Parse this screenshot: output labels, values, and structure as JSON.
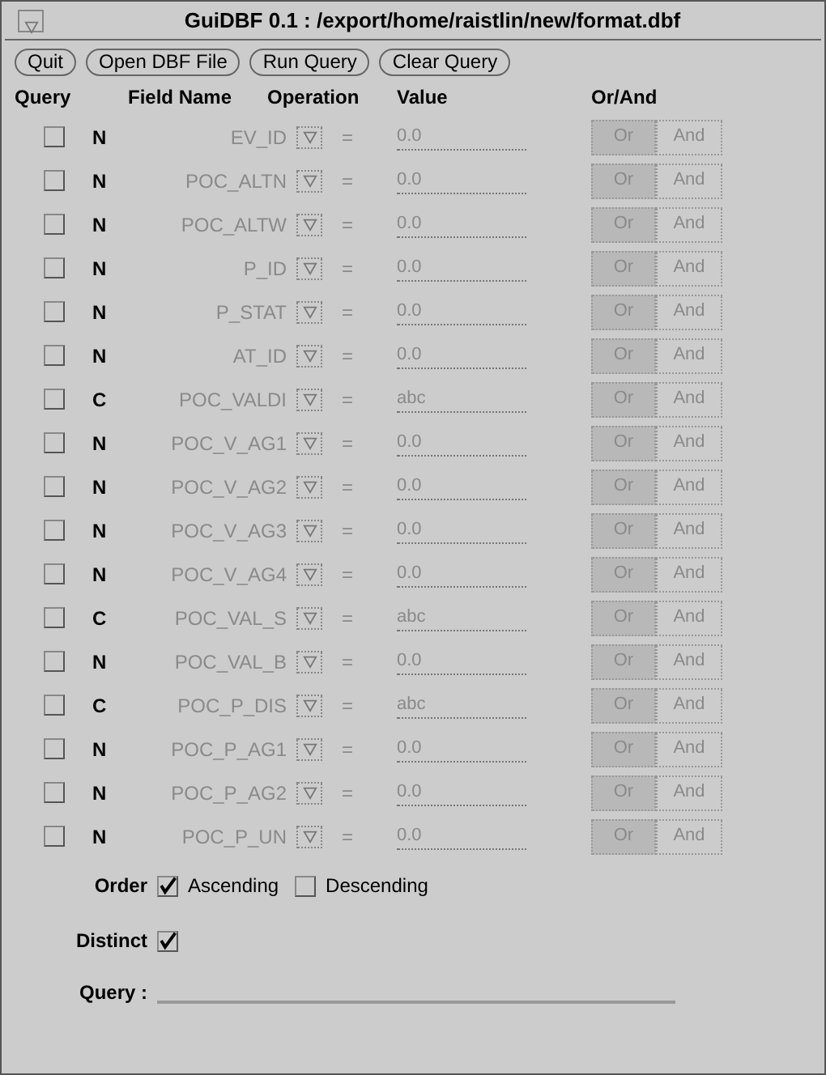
{
  "window": {
    "title": "GuiDBF 0.1 : /export/home/raistlin/new/format.dbf"
  },
  "buttons": [
    "Quit",
    "Open DBF File",
    "Run Query",
    "Clear Query"
  ],
  "columns": [
    "Query",
    "Field Name",
    "Operation",
    "Value",
    "Or/And"
  ],
  "rows": [
    {
      "checked": false,
      "type": "N",
      "field_name": "EV_ID",
      "operation": "=",
      "value": "0.0",
      "disabled": true,
      "or": {
        "label": "Or",
        "selected": true
      },
      "and": {
        "label": "And",
        "selected": false
      }
    },
    {
      "checked": false,
      "type": "N",
      "field_name": "POC_ALTN",
      "operation": "=",
      "value": "0.0",
      "disabled": true,
      "or": {
        "label": "Or",
        "selected": true
      },
      "and": {
        "label": "And",
        "selected": false
      }
    },
    {
      "checked": false,
      "type": "N",
      "field_name": "POC_ALTW",
      "operation": "=",
      "value": "0.0",
      "disabled": true,
      "or": {
        "label": "Or",
        "selected": true
      },
      "and": {
        "label": "And",
        "selected": false
      }
    },
    {
      "checked": false,
      "type": "N",
      "field_name": "P_ID",
      "operation": "=",
      "value": "0.0",
      "disabled": true,
      "or": {
        "label": "Or",
        "selected": true
      },
      "and": {
        "label": "And",
        "selected": false
      }
    },
    {
      "checked": false,
      "type": "N",
      "field_name": "P_STAT",
      "operation": "=",
      "value": "0.0",
      "disabled": true,
      "or": {
        "label": "Or",
        "selected": true
      },
      "and": {
        "label": "And",
        "selected": false
      }
    },
    {
      "checked": false,
      "type": "N",
      "field_name": "AT_ID",
      "operation": "=",
      "value": "0.0",
      "disabled": true,
      "or": {
        "label": "Or",
        "selected": true
      },
      "and": {
        "label": "And",
        "selected": false
      }
    },
    {
      "checked": false,
      "type": "C",
      "field_name": "POC_VALDI",
      "operation": "=",
      "value": "abc",
      "disabled": true,
      "or": {
        "label": "Or",
        "selected": true
      },
      "and": {
        "label": "And",
        "selected": false
      }
    },
    {
      "checked": false,
      "type": "N",
      "field_name": "POC_V_AG1",
      "operation": "=",
      "value": "0.0",
      "disabled": true,
      "or": {
        "label": "Or",
        "selected": true
      },
      "and": {
        "label": "And",
        "selected": false
      }
    },
    {
      "checked": false,
      "type": "N",
      "field_name": "POC_V_AG2",
      "operation": "=",
      "value": "0.0",
      "disabled": true,
      "or": {
        "label": "Or",
        "selected": true
      },
      "and": {
        "label": "And",
        "selected": false
      }
    },
    {
      "checked": false,
      "type": "N",
      "field_name": "POC_V_AG3",
      "operation": "=",
      "value": "0.0",
      "disabled": true,
      "or": {
        "label": "Or",
        "selected": true
      },
      "and": {
        "label": "And",
        "selected": false
      }
    },
    {
      "checked": false,
      "type": "N",
      "field_name": "POC_V_AG4",
      "operation": "=",
      "value": "0.0",
      "disabled": true,
      "or": {
        "label": "Or",
        "selected": true
      },
      "and": {
        "label": "And",
        "selected": false
      }
    },
    {
      "checked": false,
      "type": "C",
      "field_name": "POC_VAL_S",
      "operation": "=",
      "value": "abc",
      "disabled": true,
      "or": {
        "label": "Or",
        "selected": true
      },
      "and": {
        "label": "And",
        "selected": false
      }
    },
    {
      "checked": false,
      "type": "N",
      "field_name": "POC_VAL_B",
      "operation": "=",
      "value": "0.0",
      "disabled": true,
      "or": {
        "label": "Or",
        "selected": true
      },
      "and": {
        "label": "And",
        "selected": false
      }
    },
    {
      "checked": false,
      "type": "C",
      "field_name": "POC_P_DIS",
      "operation": "=",
      "value": "abc",
      "disabled": true,
      "or": {
        "label": "Or",
        "selected": true
      },
      "and": {
        "label": "And",
        "selected": false
      }
    },
    {
      "checked": false,
      "type": "N",
      "field_name": "POC_P_AG1",
      "operation": "=",
      "value": "0.0",
      "disabled": true,
      "or": {
        "label": "Or",
        "selected": true
      },
      "and": {
        "label": "And",
        "selected": false
      }
    },
    {
      "checked": false,
      "type": "N",
      "field_name": "POC_P_AG2",
      "operation": "=",
      "value": "0.0",
      "disabled": true,
      "or": {
        "label": "Or",
        "selected": true
      },
      "and": {
        "label": "And",
        "selected": false
      }
    },
    {
      "checked": false,
      "type": "N",
      "field_name": "POC_P_UN",
      "operation": "=",
      "value": "0.0",
      "disabled": true,
      "or": {
        "label": "Or",
        "selected": true
      },
      "and": {
        "label": "And",
        "selected": false
      }
    }
  ],
  "order": {
    "label": "Order",
    "options": [
      {
        "label": "Ascending",
        "checked": true
      },
      {
        "label": "Descending",
        "checked": false
      }
    ]
  },
  "distinct": {
    "label": "Distinct",
    "checked": true
  },
  "query": {
    "label": "Query :"
  }
}
